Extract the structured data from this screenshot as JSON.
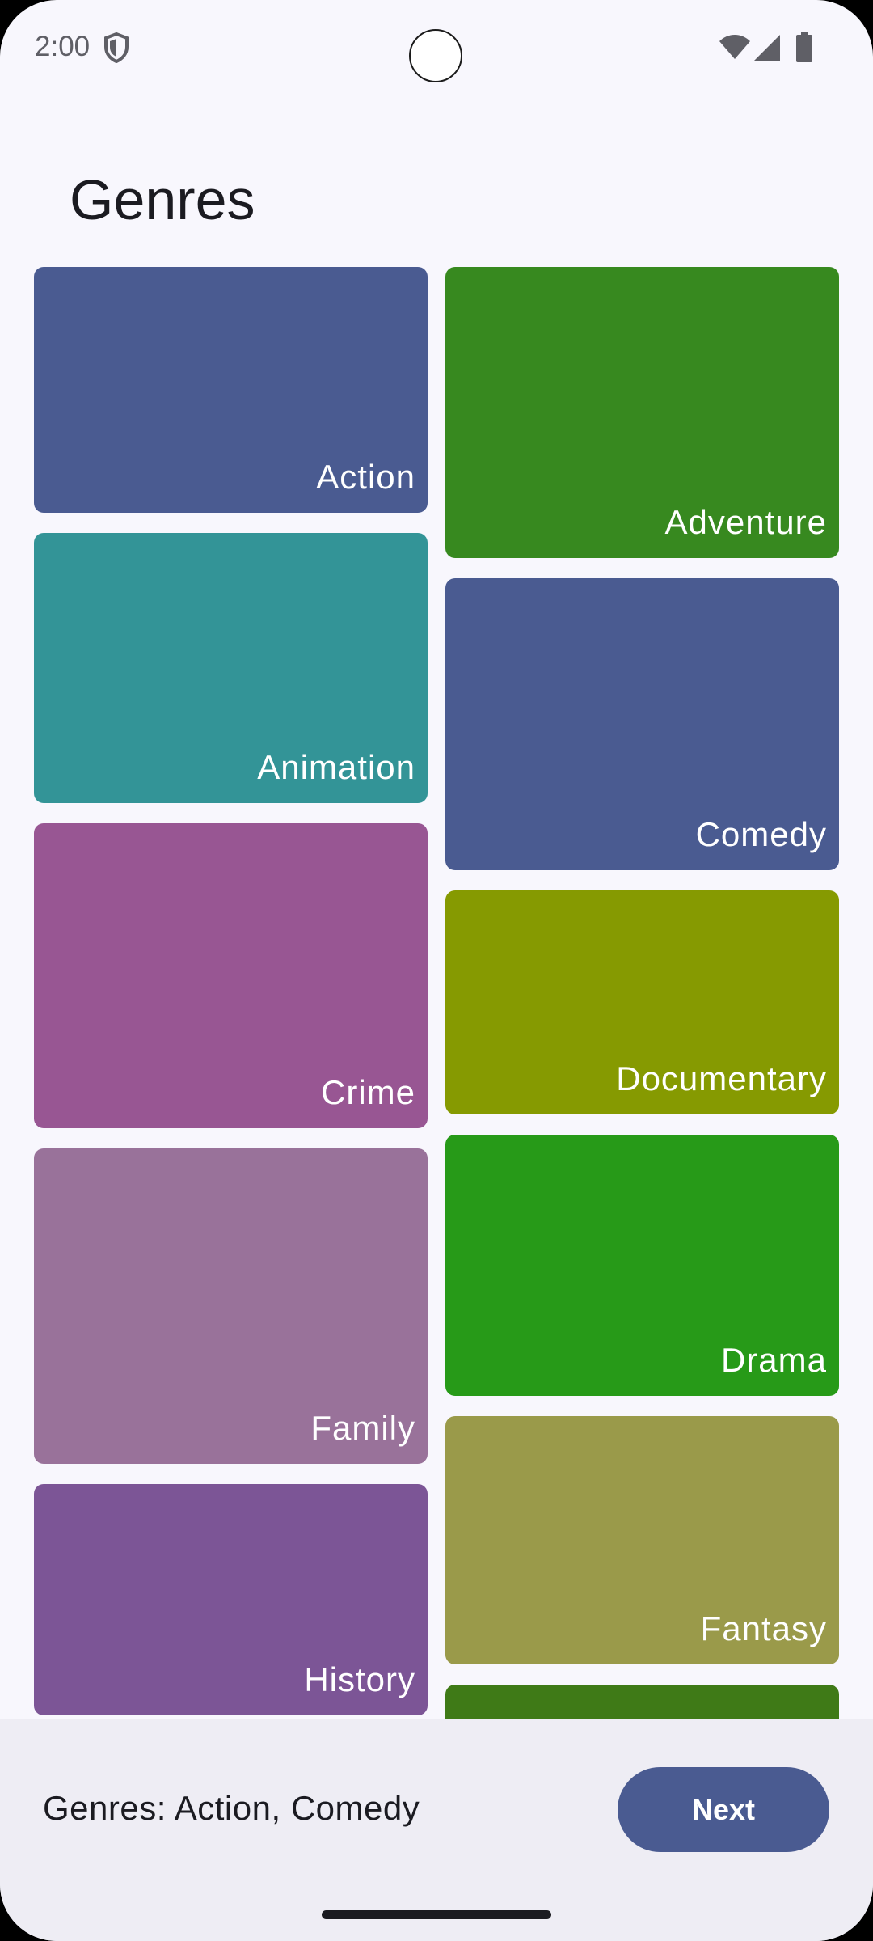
{
  "status_bar": {
    "time": "2:00",
    "icons": [
      "shield-icon",
      "wifi-icon",
      "signal-icon",
      "battery-icon"
    ]
  },
  "header": {
    "title": "Genres"
  },
  "genres": {
    "left": [
      {
        "label": "Action",
        "color": "#4a5b91"
      },
      {
        "label": "Animation",
        "color": "#339497"
      },
      {
        "label": "Crime",
        "color": "#985693"
      },
      {
        "label": "Family",
        "color": "#99729a"
      },
      {
        "label": "History",
        "color": "#7c5596"
      }
    ],
    "right": [
      {
        "label": "Adventure",
        "color": "#37891f"
      },
      {
        "label": "Comedy",
        "color": "#4a5b91"
      },
      {
        "label": "Documentary",
        "color": "#869a01"
      },
      {
        "label": "Drama",
        "color": "#279a18"
      },
      {
        "label": "Fantasy",
        "color": "#9a9a4a"
      },
      {
        "label": "",
        "color": "#3f7a17"
      }
    ]
  },
  "bottom_bar": {
    "selection_text": "Genres: Action, Comedy",
    "next_label": "Next"
  },
  "colors": {
    "background": "#f8f7fd",
    "bottom_bar": "#eeedf4",
    "primary": "#4a5b91",
    "text": "#1b1b21"
  }
}
